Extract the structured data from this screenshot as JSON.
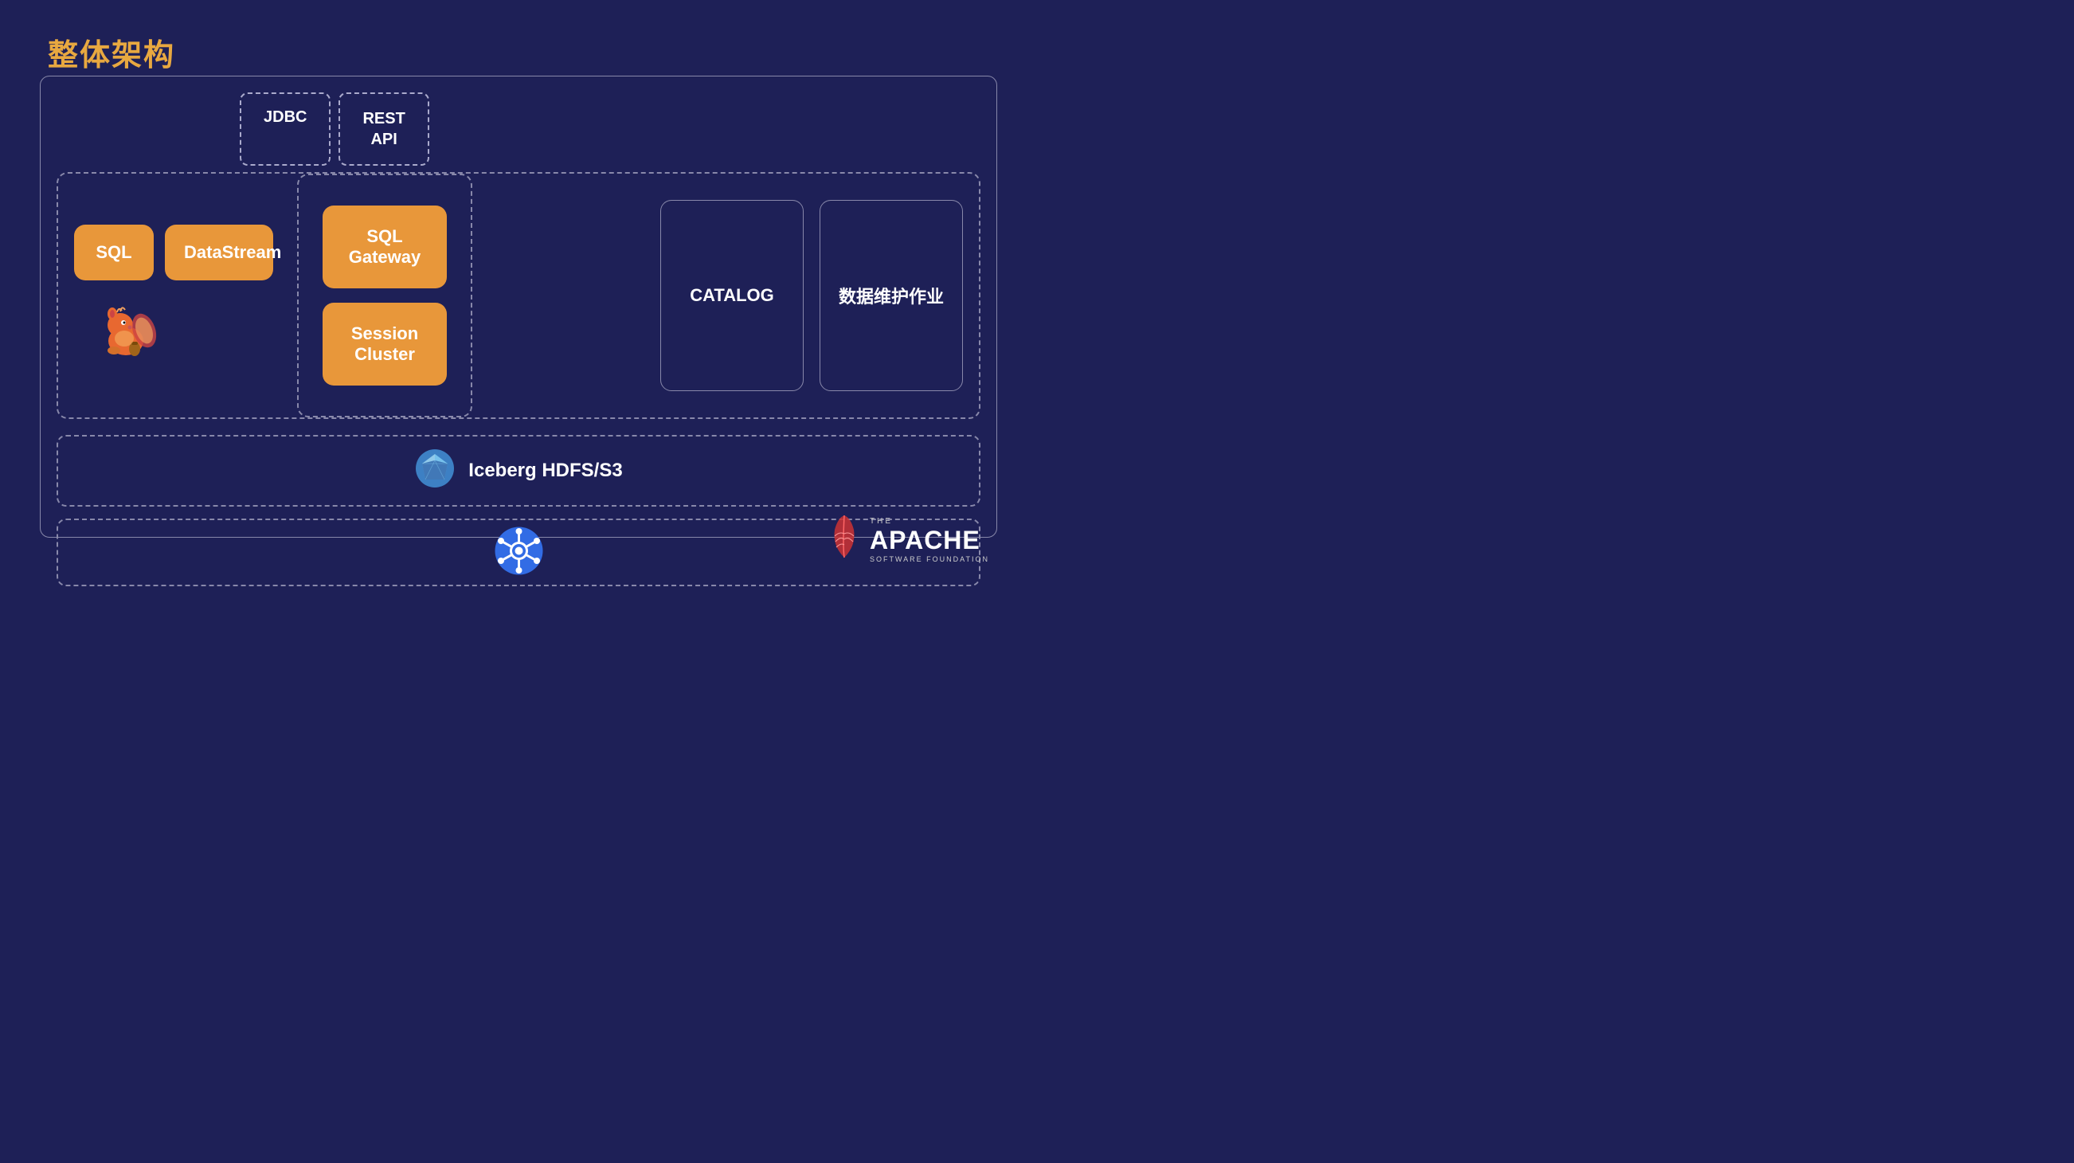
{
  "title": "整体架构",
  "api_boxes": [
    {
      "label": "JDBC"
    },
    {
      "label": "REST\nAPI"
    }
  ],
  "left_boxes": [
    {
      "label": "SQL"
    },
    {
      "label": "DataStream"
    }
  ],
  "center_boxes": [
    {
      "label": "SQL Gateway"
    },
    {
      "label": "Session Cluster"
    }
  ],
  "right_boxes": [
    {
      "label": "CATALOG"
    },
    {
      "label": "数据维护作业"
    }
  ],
  "bottom1_text": "Iceberg HDFS/S3",
  "bottom2_label": "kubernetes",
  "apache": {
    "the": "THE",
    "name": "APACHE",
    "sub": "SOFTWARE FOUNDATION"
  }
}
